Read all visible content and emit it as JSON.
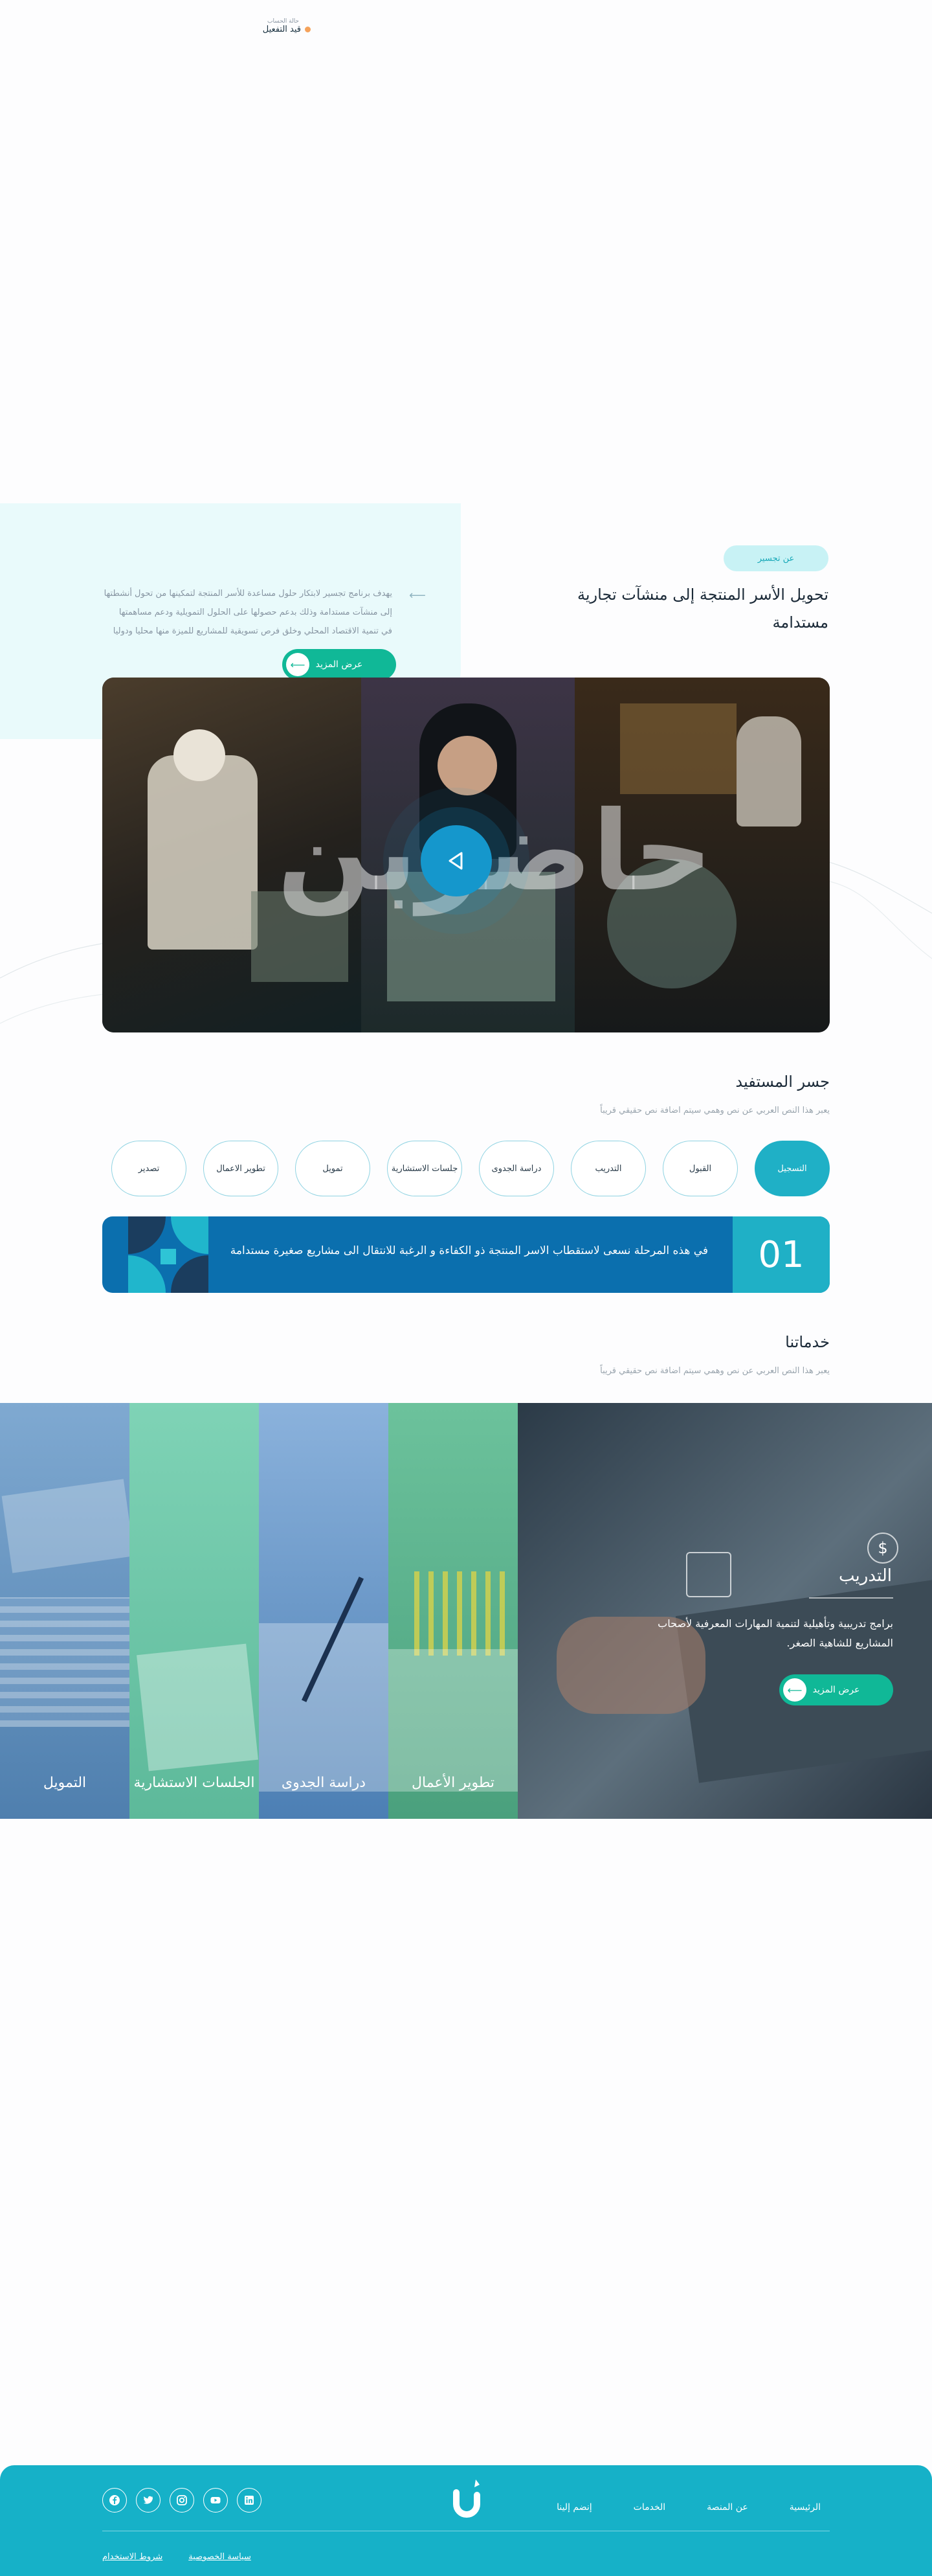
{
  "status": {
    "label": "حالة الحساب",
    "value": "قيد التفعيل",
    "dot_color": "#f5a25b"
  },
  "about": {
    "tag": "عن تجسير",
    "title": "تحويل الأسر المنتجة إلى منشآت تجارية مستدامة",
    "desc_lines": [
      "يهدف برنامج تجسير لابتكار حلول مساعدة للأسر المنتجة لتمكينها من تحول أنشطتها",
      "إلى منشآت مستدامة وذلك بدعم حصولها على الحلول التمويلية ودعم مساهمتها",
      "في تنمية الاقتصاد المحلي وخلق فرص تسويقية للمشاريع للميزة منها محليا ودوليا"
    ],
    "more_label": "عرض المزيد",
    "hero_word": "حاضربن"
  },
  "bridge": {
    "title": "جسر المستفيد",
    "subtitle": "يعبر هذا النص العربي عن نص وهمي سيتم اضافة نص حقيقي قريباً",
    "steps": [
      {
        "label": "التسجيل"
      },
      {
        "label": "القبول"
      },
      {
        "label": "التدريب"
      },
      {
        "label": "دراسة الجدوى"
      },
      {
        "label": "جلسات الاستشارية"
      },
      {
        "label": "تمويل"
      },
      {
        "label": "تطوير الاعمال"
      },
      {
        "label": "تصدير"
      }
    ],
    "active_number": "01",
    "active_text": "في هذه المرحلة نسعى لاستقطاب الاسر المنتجة ذو الكفاءة و الرغبة للانتقال الى مشاريع صغيرة مستدامة"
  },
  "services": {
    "title": "خدماتنا",
    "subtitle": "يعبر هذا النص العربي عن نص وهمي سيتم اضافة نص حقيقي قريباً",
    "featured": {
      "title": "التدريب",
      "desc": "برامج تدريبية وتأهيلية لتنمية المهارات المعرفية لأصحاب المشاريع للشاهية الصغر.",
      "more_label": "عرض المزيد"
    },
    "items": [
      {
        "label": "تطوير الأعمال"
      },
      {
        "label": "دراسة الجدوى"
      },
      {
        "label": "الجلسات الاستشارية"
      },
      {
        "label": "التمويل"
      }
    ]
  },
  "footer": {
    "nav": [
      "الرئيسية",
      "عن المنصة",
      "الخدمات",
      "إنضم إلينا"
    ],
    "links": [
      "سياسة الخصوصية",
      "شروط الاستخدام"
    ],
    "social": [
      "linkedin-icon",
      "youtube-icon",
      "instagram-icon",
      "twitter-icon",
      "facebook-icon"
    ]
  },
  "colors": {
    "brand": "#16b1c8",
    "green": "#10b897",
    "navy": "#0b6fae"
  }
}
